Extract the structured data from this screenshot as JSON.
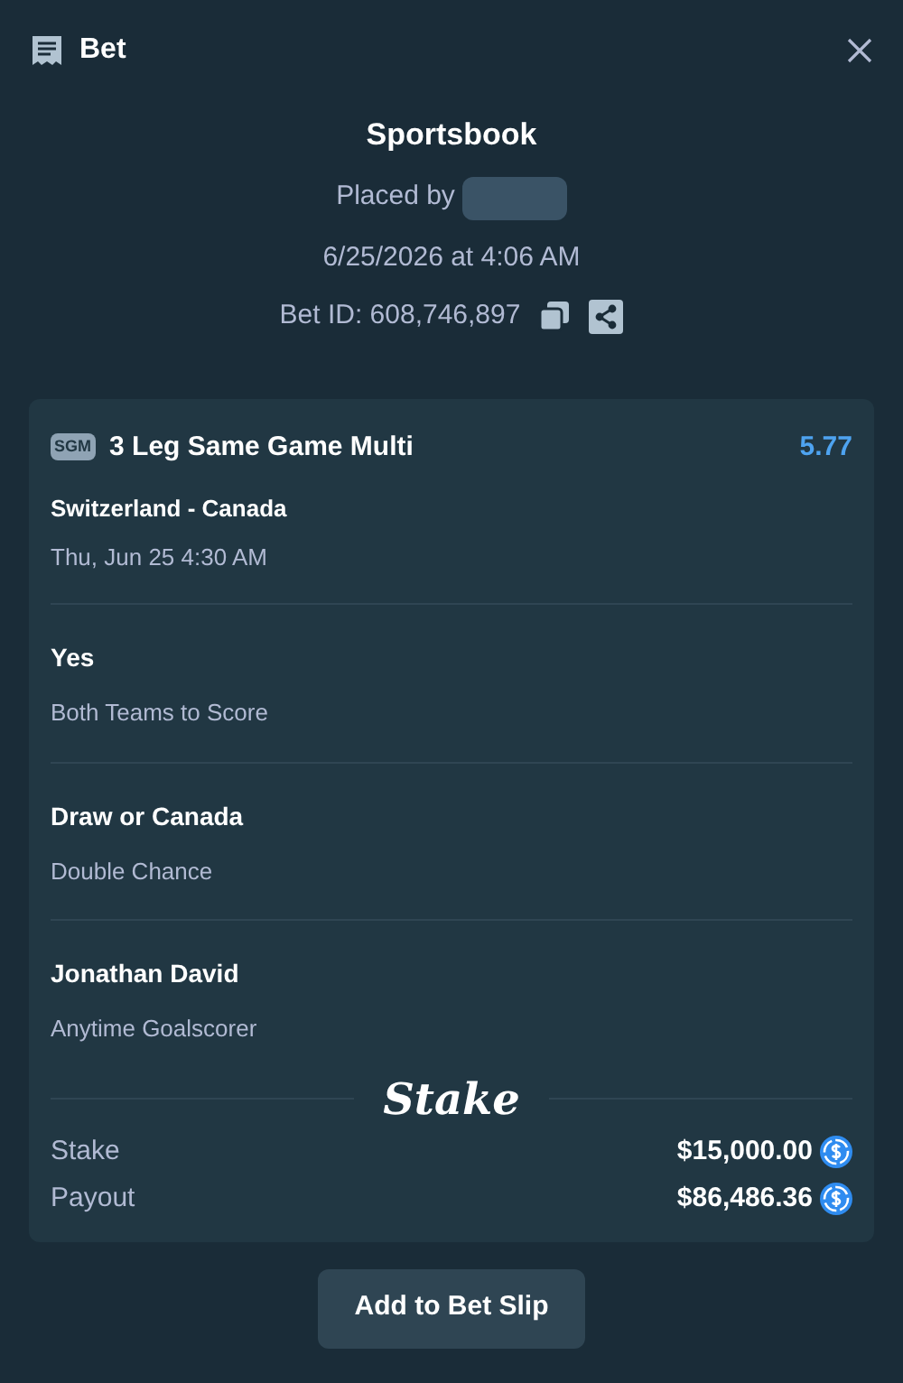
{
  "window": {
    "title": "Bet"
  },
  "header": {
    "title": "Sportsbook",
    "placed_by": "Placed by",
    "date": "6/25/2026 at 4:06 AM",
    "bet_id": "Bet ID: 608,746,897"
  },
  "bet": {
    "badge": "SGM",
    "title": "3 Leg Same Game Multi",
    "odds": "5.77",
    "match": "Switzerland - Canada",
    "time": "Thu, Jun 25 4:30 AM",
    "legs": [
      {
        "selection": "Yes",
        "market": "Both Teams to Score"
      },
      {
        "selection": "Draw or Canada",
        "market": "Double Chance"
      },
      {
        "selection": "Jonathan David",
        "market": "Anytime Goalscorer"
      }
    ],
    "logo": "Stake",
    "totals": [
      {
        "label": "Stake",
        "value": "$15,000.00"
      },
      {
        "label": "Payout",
        "value": "$86,486.36"
      }
    ]
  },
  "button": "Add to Bet Slip"
}
